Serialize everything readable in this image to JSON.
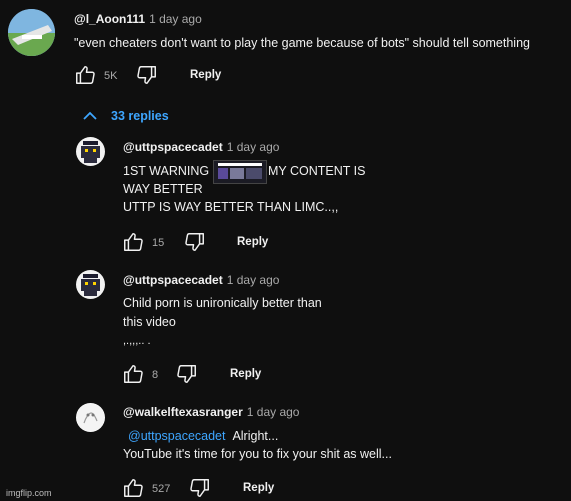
{
  "top_comment": {
    "handle": "@l_Aoon111",
    "time": "1 day ago",
    "text": "\"even cheaters don't want to play the game because of bots\" should tell something",
    "likes": "5K",
    "reply_label": "Reply"
  },
  "replies_toggle": {
    "label": "33 replies",
    "icon": "chevron-up-icon"
  },
  "replies": [
    {
      "handle": "@uttpspacecadet",
      "time": "1 day ago",
      "line1_before": "1ST WARNING",
      "line1_after": "MY CONTENT IS",
      "line2": "WAY BETTER",
      "line3": "UTTP IS WAY BETTER THAN LIMC..,,",
      "likes": "15",
      "reply_label": "Reply"
    },
    {
      "handle": "@uttpspacecadet",
      "time": "1 day ago",
      "line1": "Child porn is unironically better than",
      "line2": "this video",
      "line3": ",.,,,.. .",
      "likes": "8",
      "reply_label": "Reply"
    },
    {
      "handle": "@walkelftexasranger",
      "time": "1 day ago",
      "mention": "@uttpspacecadet",
      "line1": "Alright...",
      "line2": "YouTube it's time for you to fix your shit as well...",
      "likes": "527",
      "reply_label": "Reply"
    }
  ],
  "watermark": "imgflip.com",
  "colors": {
    "background": "#0f0f0f",
    "text": "#f1f1f1",
    "secondary": "#aaaaaa",
    "link": "#3ea6ff"
  }
}
